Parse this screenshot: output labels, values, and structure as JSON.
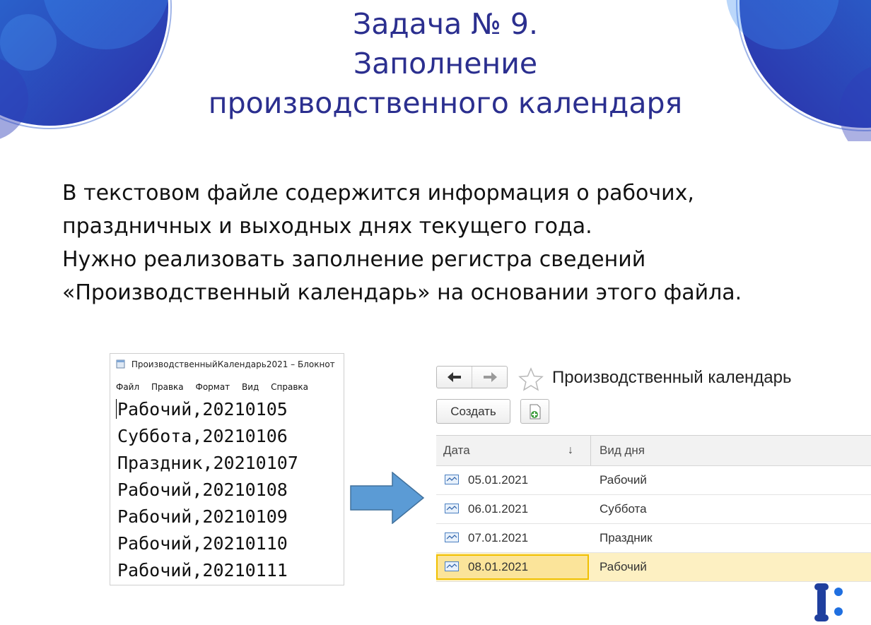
{
  "slide": {
    "title_lines": [
      "Задача № 9.",
      "Заполнение",
      "производственного календаря"
    ],
    "description_lines": [
      "В текстовом файле содержится информация о рабочих,",
      "праздничных и выходных днях текущего года.",
      "Нужно реализовать заполнение регистра сведений",
      "«Производственный календарь» на основании этого файла."
    ],
    "colors": {
      "title": "#2b2f8f",
      "deco_blue": "#1f56c8",
      "arrow": "#5b9bd5"
    }
  },
  "notepad": {
    "window_title": "ПроизводственныйКалендарь2021 – Блокнот",
    "menu": [
      "Файл",
      "Правка",
      "Формат",
      "Вид",
      "Справка"
    ],
    "lines": [
      "Рабочий,20210105",
      "Суббота,20210106",
      "Праздник,20210107",
      "Рабочий,20210108",
      "Рабочий,20210109",
      "Рабочий,20210110",
      "Рабочий,20210111"
    ]
  },
  "form": {
    "title": "Производственный календарь",
    "back_icon": "arrow-left",
    "forward_icon": "arrow-right",
    "favorite_icon": "star-outline",
    "create_label": "Создать",
    "copy_icon": "add-document-icon",
    "columns": {
      "date": "Дата",
      "sort_indicator": "↓",
      "kind": "Вид дня"
    },
    "rows": [
      {
        "date": "05.01.2021",
        "kind": "Рабочий",
        "selected": false
      },
      {
        "date": "06.01.2021",
        "kind": "Суббота",
        "selected": false
      },
      {
        "date": "07.01.2021",
        "kind": "Праздник",
        "selected": false
      },
      {
        "date": "08.01.2021",
        "kind": "Рабочий",
        "selected": true
      }
    ]
  }
}
